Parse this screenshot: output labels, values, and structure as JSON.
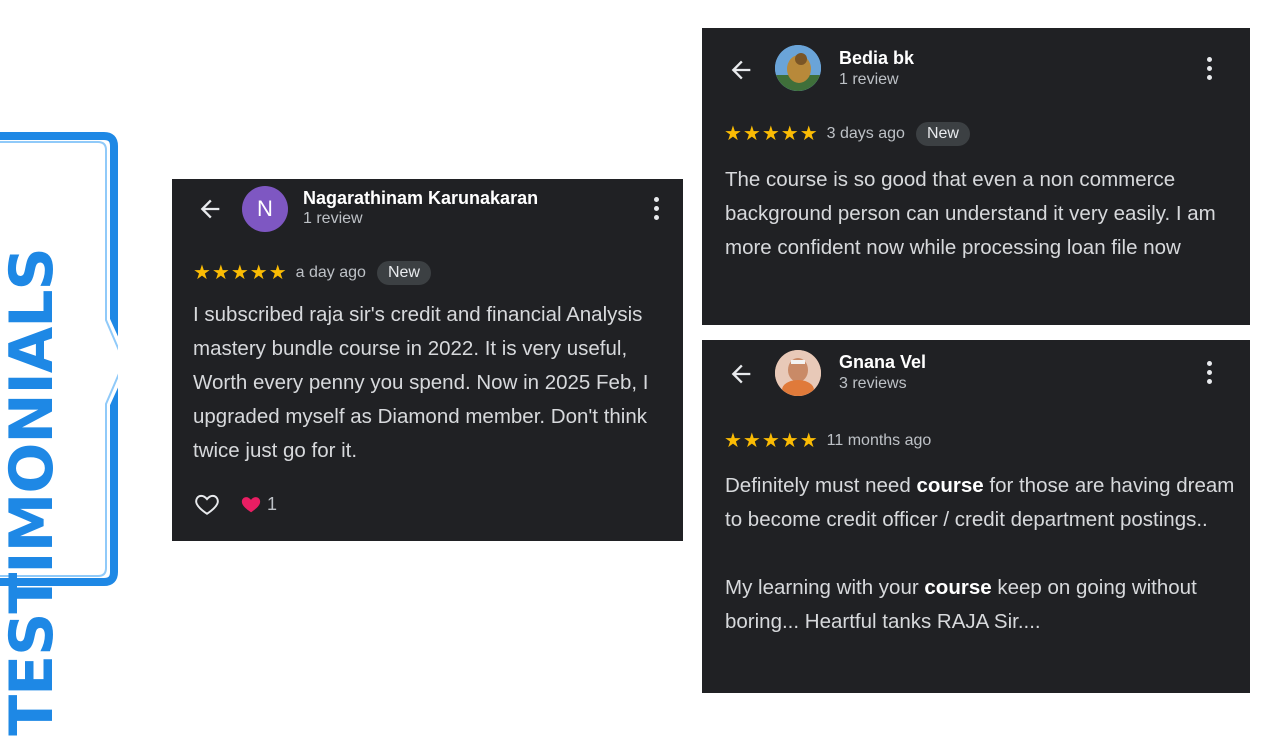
{
  "banner": {
    "text": "TESTIMONIALS",
    "color": "#1e88e5"
  },
  "reviews": [
    {
      "name": "Nagarathinam Karunakaran",
      "review_count": "1 review",
      "avatar_letter": "N",
      "avatar_color": "#7e57c2",
      "stars": "★★★★★",
      "rating": 5,
      "age": "a day ago",
      "badge": "New",
      "text": "I subscribed raja sir's credit and financial Analysis mastery bundle course in 2022. It is very useful, Worth every penny you spend. Now in 2025 Feb, I upgraded myself as Diamond member. Don't think twice just go for it.",
      "reaction_count": "1"
    },
    {
      "name": "Bedia bk",
      "review_count": "1 review",
      "stars": "★★★★★",
      "rating": 5,
      "age": "3 days ago",
      "badge": "New",
      "text": "The course is so good that even a non commerce background person can understand it very easily. I am more confident now while processing loan file now"
    },
    {
      "name": "Gnana Vel",
      "review_count": "3 reviews",
      "stars": "★★★★★",
      "rating": 5,
      "age": "11 months ago",
      "text_p1_a": "Definitely must need ",
      "text_p1_b": "course",
      "text_p1_c": " for those are having dream to become credit officer / credit department postings..",
      "text_p2_a": "My learning with your ",
      "text_p2_b": "course",
      "text_p2_c": " keep on going without boring... Heartful tanks RAJA Sir...."
    }
  ],
  "colors": {
    "card_bg": "#202124",
    "star": "#fbbc04",
    "heart": "#e91e63"
  }
}
